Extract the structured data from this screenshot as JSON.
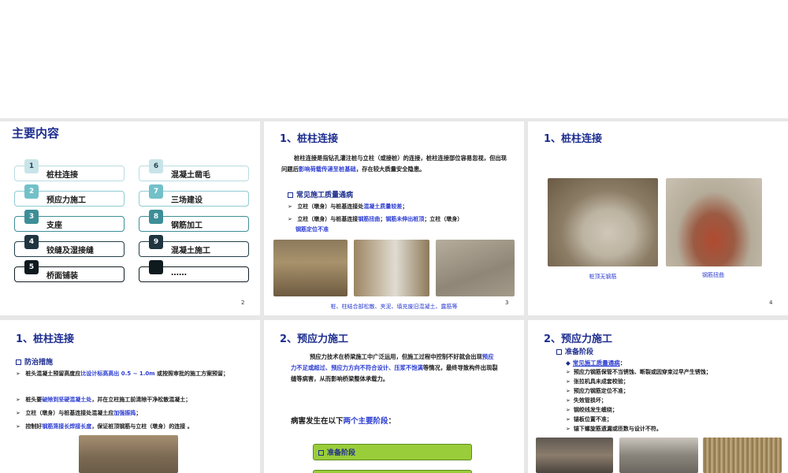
{
  "slides": {
    "s1": {
      "title": "主要内容",
      "page": "2",
      "items": [
        {
          "num": "1",
          "label": "桩柱连接"
        },
        {
          "num": "2",
          "label": "预应力施工"
        },
        {
          "num": "3",
          "label": "支座"
        },
        {
          "num": "4",
          "label": "铰缝及湿接缝"
        },
        {
          "num": "5",
          "label": "桥面铺装"
        },
        {
          "num": "6",
          "label": "混凝土凿毛"
        },
        {
          "num": "7",
          "label": "三场建设"
        },
        {
          "num": "8",
          "label": "钢筋加工"
        },
        {
          "num": "9",
          "label": "混凝土施工"
        },
        {
          "num": "",
          "label": "……"
        }
      ]
    },
    "s2": {
      "title": "1、桩柱连接",
      "page": "3",
      "para_a": "桩柱连接是指钻孔灌注桩与立柱（或接桩）的连接，桩柱连接部位容易忽视，但出现问题后",
      "para_hl": "影响荷载传递至桩基础",
      "para_b": "，存在较大质量安全隐患。",
      "sub": "常见施工质量通病",
      "b1_a": "立柱（墩身）与桩基连接处",
      "b1_hl": "混凝土质量较差",
      "b1_b": "；",
      "b2_a": "立柱（墩身）与桩基连接",
      "b2_hl1": "钢筋扭曲",
      "b2_mid": "；",
      "b2_hl2": "钢筋未伸出桩顶",
      "b2_b": "；立柱（墩身）",
      "b2_hl3": "钢筋定位不准",
      "caption": "桩、柱结合部松散、夹泥、填充废旧混凝土、露筋等"
    },
    "s3": {
      "title": "1、桩柱连接",
      "page": "4",
      "cap1": "桩顶无钢筋",
      "cap2": "钢筋扭曲"
    },
    "s4": {
      "title": "1、桩柱连接",
      "sub": "防治措施",
      "b1_a": "桩头混凝土预留高度应",
      "b1_hl": "比设计标高高出 0.5 ~ 1.0m",
      "b1_b": " 或按照审批的施工方案预留；",
      "b2_a": "桩头要",
      "b2_hl": "破除到坚硬混凝土处",
      "b2_b": "，并在立柱施工前清除干净松散混凝土；",
      "b3_a": "立柱（墩身）与桩基连接处混凝土应",
      "b3_hl": "加强振捣",
      "b3_b": "；",
      "b4_a": "控制好",
      "b4_hl": "钢筋笼接长焊接长度",
      "b4_b": "，保证桩顶钢筋与立柱（墩身）的连接 。"
    },
    "s5": {
      "title": "2、预应力施工",
      "para_a": "预应力技术在桥梁施工中广泛运用，但施工过程中控制不好就会出现",
      "para_hl": "预应力不足或超过、预应力方向不符合设计、压浆不饱满",
      "para_b": "等情况，最终导致构件出现裂缝等病害，从而影响桥梁整体承载力。",
      "stage_a": "病害发生在以下",
      "stage_hl": "两个主要阶段",
      "stage_b": "：",
      "box1": "准备阶段"
    },
    "s6": {
      "title": "2、预应力施工",
      "sub": "准备阶段",
      "sub2": "常见施工质量通病",
      "sub2_tail": "：",
      "items": [
        "预应力钢筋保管不当锈蚀、断裂或因穿束过早产生锈蚀；",
        "张拉机具未成套校验；",
        "预应力钢筋定位不准；",
        "失效管损坏；",
        "钢绞线发生缠绕；",
        "锚板位置不准；",
        "锚下螺旋筋遗漏或匝数与设计不符。"
      ]
    }
  }
}
